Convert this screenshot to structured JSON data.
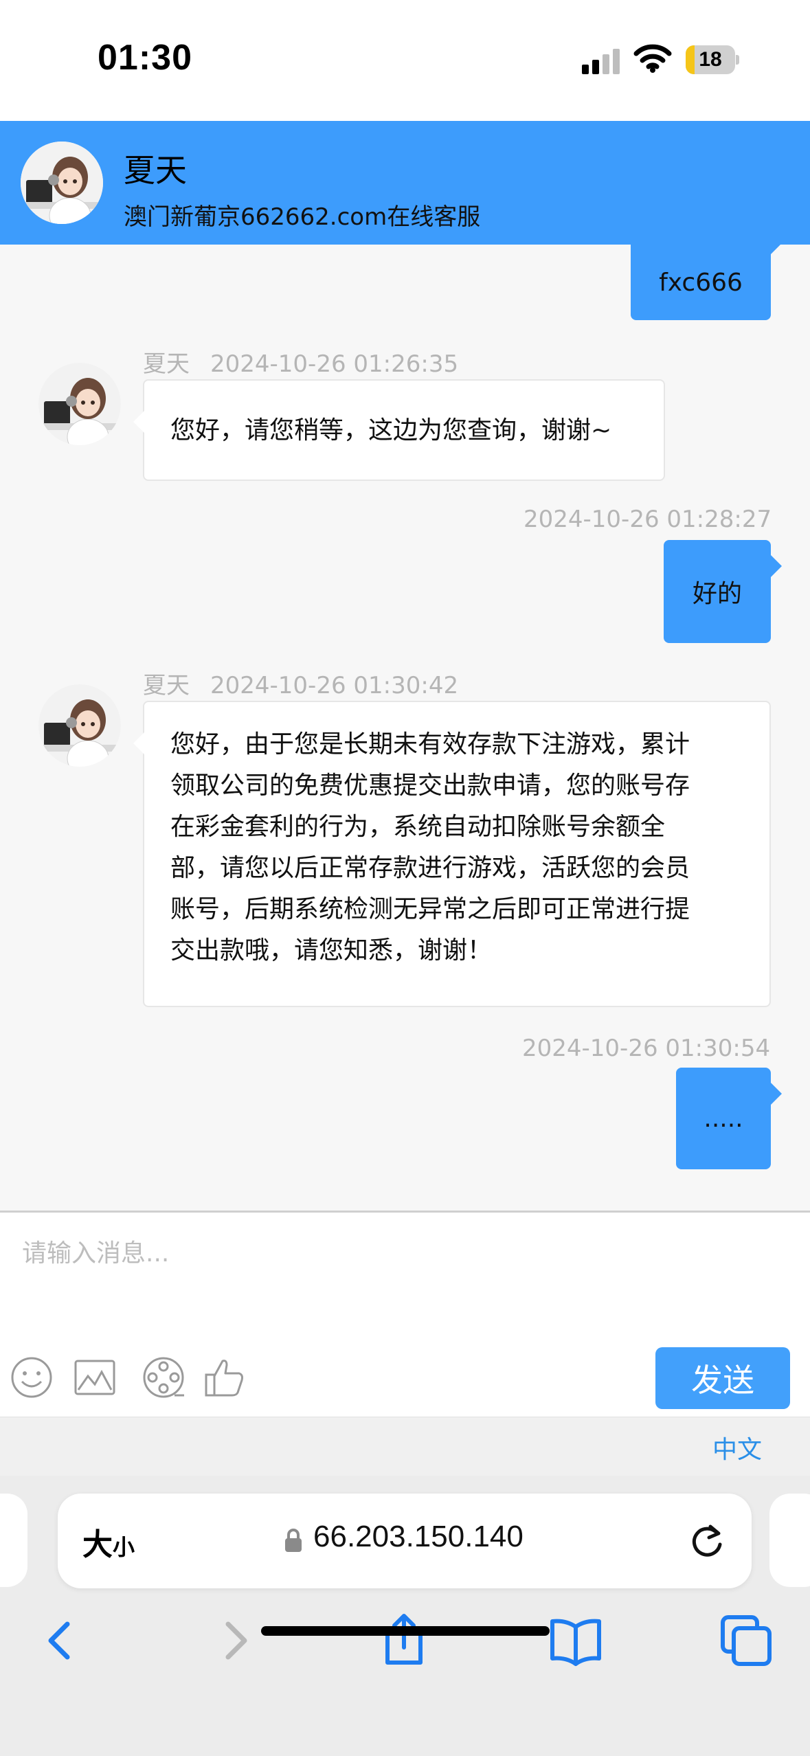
{
  "status_bar": {
    "time": "01:30",
    "battery": "18",
    "battery_level": 0.18
  },
  "header": {
    "agent_name": "夏天",
    "subtitle": "澳门新葡京662662.com在线客服"
  },
  "messages": [
    {
      "direction": "out",
      "text": "fxc666"
    },
    {
      "direction": "in",
      "sender": "夏天",
      "time": "2024-10-26 01:26:35",
      "text": "您好，请您稍等，这边为您查询，谢谢~"
    },
    {
      "direction": "out",
      "time": "2024-10-26 01:28:27",
      "text": "好的"
    },
    {
      "direction": "in",
      "sender": "夏天",
      "time": "2024-10-26 01:30:42",
      "lines": [
        "您好，由于您是长期未有效存款下注游戏，累计",
        "领取公司的免费优惠提交出款申请，您的账号存",
        "在彩金套利的行为，系统自动扣除账号余额全",
        "部，请您以后正常存款进行游戏，活跃您的会员",
        "账号，后期系统检测无异常之后即可正常进行提",
        "交出款哦，请您知悉，谢谢！"
      ]
    },
    {
      "direction": "out",
      "time": "2024-10-26 01:30:54",
      "text": "....."
    }
  ],
  "composer": {
    "placeholder": "请输入消息...",
    "send_label": "发送",
    "tools": [
      "emoji-icon",
      "image-icon",
      "video-icon",
      "thumbs-up-icon"
    ]
  },
  "language": "中文",
  "browser": {
    "text_size_label_big": "大",
    "text_size_label_small": "小",
    "url": "66.203.150.140"
  },
  "colors": {
    "brand_blue": "#3d9cfc",
    "send_blue": "#42a0fb",
    "link_blue": "#2a8fe8"
  }
}
